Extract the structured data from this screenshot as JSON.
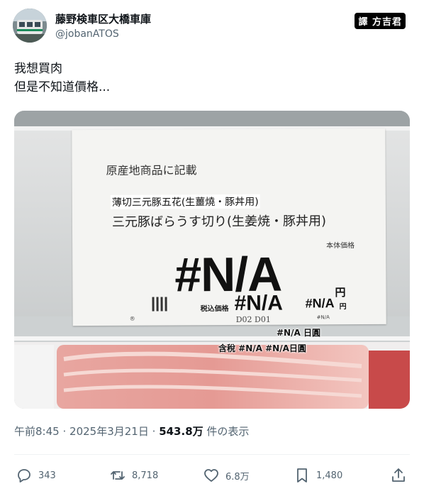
{
  "author": {
    "display_name": "藤野検車区大橋車庫",
    "handle": "@jobanATOS",
    "avatar_icon": "avatar-train-photo"
  },
  "watermark": "譯 方吉君",
  "tweet": {
    "lines": [
      "我想買肉",
      "但是不知道價格..."
    ]
  },
  "photo": {
    "label": {
      "origin_text": "原産地商品に記載",
      "subtitle_overlay": "薄切三元豚五花(生薑燒・豚丼用)",
      "product_name": "三元豚ばらうす切り(生姜焼・豚丼用)",
      "base_price_label": "本体価格",
      "base_price": "#N/A",
      "yen": "円",
      "tax_label": "税込価格",
      "tax_price": "#N/A",
      "tax_price_small": "#N/A",
      "tax_yen": "円",
      "small_na": "#N/A",
      "mark": "®",
      "handwritten": "D02 D01"
    },
    "caption_lines": [
      "#N/A 日圓",
      "含稅 #N/A #N/A日圓"
    ]
  },
  "meta": {
    "time": "午前8:45",
    "date": "2025年3月21日",
    "separator": "·",
    "views": "543.8万",
    "views_suffix": "件の表示"
  },
  "actions": {
    "reply_count": "343",
    "retweet_count": "8,718",
    "like_count": "6.8万",
    "bookmark_count": "1,480"
  },
  "colors": {
    "text_primary": "#0f1419",
    "text_secondary": "#536471",
    "divider": "#eff3f4"
  }
}
